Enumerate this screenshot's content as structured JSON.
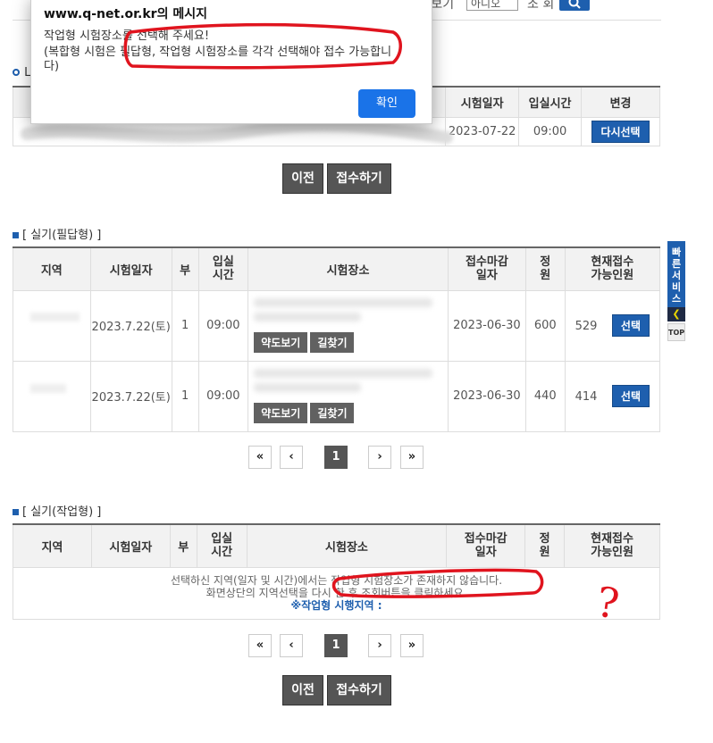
{
  "search": {
    "label_view": "방 보기",
    "select_value": "아니오",
    "label_search": "조 회"
  },
  "dialog": {
    "title": "www.q-net.or.kr의 메시지",
    "line1": "작업형 시험장소를 선택해 주세요!",
    "line2": "(복합형 시험은 필답형, 작업형 시험장소를 각각 선택해야 접수 가능합니",
    "line3": "다)",
    "ok_label": "확인"
  },
  "selected": {
    "section_marker": "L",
    "headers": [
      "시험일자",
      "입실시간",
      "변경"
    ],
    "row": {
      "date": "2023-07-22",
      "time": "09:00",
      "change_label": "다시선택"
    }
  },
  "nav1": {
    "prev_label": "이전",
    "submit_label": "접수하기"
  },
  "written": {
    "title": "[ 실기(필답형) ]",
    "headers": {
      "region": "지역",
      "date": "시험일자",
      "part": "부",
      "entry": "입실\n시간",
      "venue": "시험장소",
      "deadline": "접수마감\n일자",
      "capacity": "정\n원",
      "available": "현재접수\n가능인원"
    },
    "rows": [
      {
        "date": "2023.7.22(토)",
        "part": "1",
        "time": "09:00",
        "map_label": "약도보기",
        "route_label": "길찾기",
        "deadline": "2023-06-30",
        "capacity": "600",
        "available": "529",
        "select_label": "선택"
      },
      {
        "date": "2023.7.22(토)",
        "part": "1",
        "time": "09:00",
        "map_label": "약도보기",
        "route_label": "길찾기",
        "deadline": "2023-06-30",
        "capacity": "440",
        "available": "414",
        "select_label": "선택"
      }
    ]
  },
  "pager1": {
    "first": "«",
    "prev": "‹",
    "page": "1",
    "next": "›",
    "last": "»"
  },
  "practical": {
    "title": "[ 실기(작업형) ]",
    "headers": {
      "region": "지역",
      "date": "시험일자",
      "part": "부",
      "entry": "입실\n시간",
      "venue": "시험장소",
      "deadline": "접수마감\n일자",
      "capacity": "정\n원",
      "available": "현재접수\n가능인원"
    },
    "empty_line1": "선택하신 지역(일자 및 시간)에서는 작업형 시험장소가 존재하지 않습니다.",
    "empty_line2": "화면상단의 지역선택을 다시 한 후 조회버튼을 클릭하세요.",
    "empty_line3": "※작업형 시행지역 :"
  },
  "pager2": {
    "first": "«",
    "prev": "‹",
    "page": "1",
    "next": "›",
    "last": "»"
  },
  "nav2": {
    "prev_label": "이전",
    "submit_label": "접수하기"
  },
  "quick_service": {
    "label": "빠른서비스",
    "top_label": "TOP"
  },
  "annotation": {
    "question_mark": "?"
  },
  "colors": {
    "primary_blue": "#1e5fae",
    "dark_button": "#555555",
    "dialog_ok": "#1a73e8",
    "annotation_red": "#e0141e"
  }
}
